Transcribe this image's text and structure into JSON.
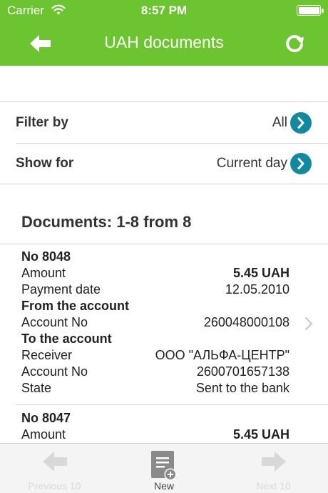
{
  "status_bar": {
    "carrier": "Carrier",
    "time": "8:57 PM"
  },
  "nav": {
    "title": "UAH documents",
    "back_icon": "arrow-left-icon",
    "refresh_icon": "refresh-icon"
  },
  "filters": [
    {
      "label": "Filter by",
      "value": "All"
    },
    {
      "label": "Show for",
      "value": "Current day"
    }
  ],
  "documents_header": "Documents: 1-8 from 8",
  "documents": [
    {
      "number": "No 8048",
      "amount_label": "Amount",
      "amount": "5.45 UAH",
      "date_label": "Payment date",
      "date": "12.05.2010",
      "from_header": "From the account",
      "from_account_label": "Account No",
      "from_account": "260048000108",
      "to_header": "To the account",
      "receiver_label": "Receiver",
      "receiver": "ООО \"АЛЬФА-ЦЕНТР\"",
      "to_account_label": "Account No",
      "to_account": "2600701657138",
      "state_label": "State",
      "state": "Sent to the bank"
    },
    {
      "number": "No 8047",
      "amount_label": "Amount",
      "amount": "5.45 UAH"
    }
  ],
  "tabbar": [
    {
      "label": "Previous 10",
      "enabled": false
    },
    {
      "label": "New",
      "enabled": true
    },
    {
      "label": "Next 10",
      "enabled": false
    }
  ],
  "colors": {
    "header_green": "#6cc530",
    "chevron_teal": "#12899e",
    "tab_bg": "#f4f4f4"
  }
}
